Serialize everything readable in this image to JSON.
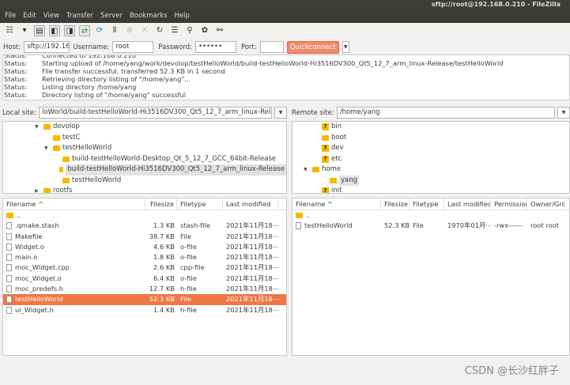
{
  "window": {
    "title": "sftp://root@192.168.0.210 - FileZilla"
  },
  "menu": [
    "File",
    "Edit",
    "View",
    "Transfer",
    "Server",
    "Bookmarks",
    "Help"
  ],
  "toolbar": [
    "site-manager-icon",
    "dropdown-icon",
    "toggle-log-icon",
    "toggle-local-tree-icon",
    "toggle-remote-tree-icon",
    "toggle-queue-icon",
    "refresh-icon",
    "process-queue-icon",
    "cancel-icon",
    "disconnect-icon",
    "reconnect-icon",
    "filter-icon",
    "compare-icon",
    "sync-browse-icon",
    "search-icon"
  ],
  "quickconnect": {
    "host_label": "Host:",
    "host": "sftp://192.168.0.2",
    "user_label": "Username:",
    "user": "root",
    "pass_label": "Password:",
    "pass": "••••••",
    "port_label": "Port:",
    "port": "",
    "button": "Quickconnect"
  },
  "log": [
    {
      "k": "Status:",
      "v": "Connected to 192.168.0.210"
    },
    {
      "k": "Status:",
      "v": "Starting upload of /home/yang/work/devolop/testHelloWorld/build-testHelloWorld-Hi3516DV300_Qt5_12_7_arm_linux-Release/testHelloWorld"
    },
    {
      "k": "Status:",
      "v": "File transfer successful, transferred 52.3 KB in 1 second"
    },
    {
      "k": "Status:",
      "v": "Retrieving directory listing of \"/home/yang\"..."
    },
    {
      "k": "Status:",
      "v": "Listing directory /home/yang"
    },
    {
      "k": "Status:",
      "v": "Directory listing of \"/home/yang\" successful"
    }
  ],
  "local": {
    "label": "Local site:",
    "path": "loWorld/build-testHelloWorld-Hi3516DV300_Qt5_12_7_arm_linux-Release/",
    "tree": [
      {
        "name": "devolop",
        "indent": 40,
        "exp": "▼"
      },
      {
        "name": "testC",
        "indent": 52,
        "exp": ""
      },
      {
        "name": "testHelloWorld",
        "indent": 52,
        "exp": "▼"
      },
      {
        "name": "build-testHelloWorld-Desktop_Qt_5_12_7_GCC_64bit-Release",
        "indent": 64,
        "exp": ""
      },
      {
        "name": "build-testHelloWorld-Hi3516DV300_Qt5_12_7_arm_linux-Release",
        "indent": 64,
        "exp": "",
        "sel": true
      },
      {
        "name": "testHelloWorld",
        "indent": 64,
        "exp": ""
      },
      {
        "name": "rootfs",
        "indent": 40,
        "exp": "▶"
      }
    ],
    "headers": [
      "Filename ^",
      "Filesize",
      "Filetype",
      "Last modified"
    ],
    "files": [
      {
        "name": "..",
        "size": "",
        "type": "",
        "mod": "",
        "dir": true
      },
      {
        "name": ".qmake.stash",
        "size": "1.3 KB",
        "type": "stash-file",
        "mod": "2021年11月18⋯"
      },
      {
        "name": "Makefile",
        "size": "38.7 KB",
        "type": "File",
        "mod": "2021年11月18⋯"
      },
      {
        "name": "Widget.o",
        "size": "4.6 KB",
        "type": "o-file",
        "mod": "2021年11月18⋯"
      },
      {
        "name": "main.o",
        "size": "1.8 KB",
        "type": "o-file",
        "mod": "2021年11月18⋯"
      },
      {
        "name": "moc_Widget.cpp",
        "size": "2.6 KB",
        "type": "cpp-file",
        "mod": "2021年11月18⋯"
      },
      {
        "name": "moc_Widget.o",
        "size": "6.4 KB",
        "type": "o-file",
        "mod": "2021年11月18⋯"
      },
      {
        "name": "moc_predefs.h",
        "size": "12.7 KB",
        "type": "h-file",
        "mod": "2021年11月18⋯"
      },
      {
        "name": "testHelloWorld",
        "size": "52.3 KB",
        "type": "File",
        "mod": "2021年11月18⋯",
        "sel": true
      },
      {
        "name": "ui_Widget.h",
        "size": "1.4 KB",
        "type": "h-file",
        "mod": "2021年11月18⋯"
      }
    ]
  },
  "remote": {
    "label": "Remote site:",
    "path": "/home/yang",
    "tree": [
      {
        "name": "bin",
        "indent": 26,
        "q": true
      },
      {
        "name": "boot",
        "indent": 26
      },
      {
        "name": "dev",
        "indent": 26,
        "q": true
      },
      {
        "name": "etc",
        "indent": 26,
        "q": true
      },
      {
        "name": "home",
        "indent": 14,
        "exp": "▼"
      },
      {
        "name": "yang",
        "indent": 36,
        "sel": true
      },
      {
        "name": "init",
        "indent": 26,
        "q": true
      }
    ],
    "headers": [
      "Filename ^",
      "Filesize",
      "Filetype",
      "Last modified",
      "Permission",
      "Owner/Gro"
    ],
    "files": [
      {
        "name": "..",
        "dir": true,
        "size": "",
        "type": "",
        "mod": "",
        "perm": "",
        "own": ""
      },
      {
        "name": "testHelloWorld",
        "size": "52.3 KB",
        "type": "File",
        "mod": "1970年01月⋯",
        "perm": "-rwx------",
        "own": "root root"
      }
    ]
  },
  "watermark": "CSDN @长沙红胖子"
}
